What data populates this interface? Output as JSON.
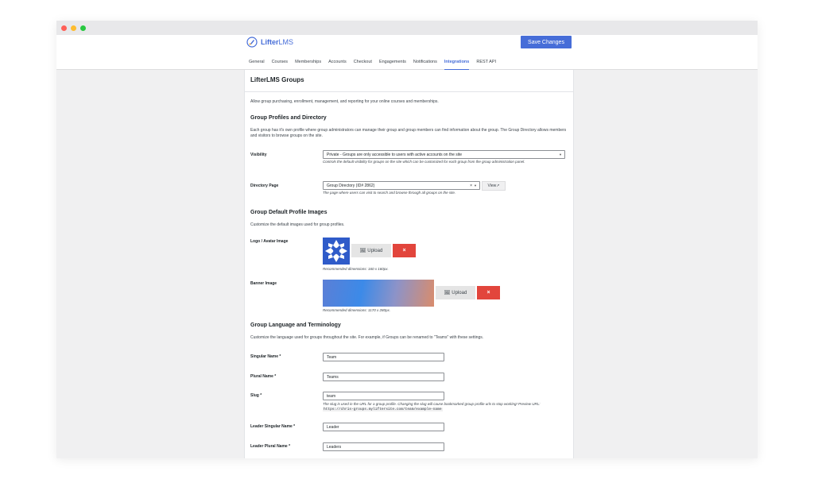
{
  "window": {
    "dots": [
      "#ff5f57",
      "#febc2e",
      "#28c840"
    ]
  },
  "header": {
    "brand_bold": "Lifter",
    "brand_light": "LMS",
    "save_label": "Save Changes",
    "accent": "#466dd8"
  },
  "tabs": [
    {
      "label": "General",
      "active": false
    },
    {
      "label": "Courses",
      "active": false
    },
    {
      "label": "Memberships",
      "active": false
    },
    {
      "label": "Accounts",
      "active": false
    },
    {
      "label": "Checkout",
      "active": false
    },
    {
      "label": "Engagements",
      "active": false
    },
    {
      "label": "Notifications",
      "active": false
    },
    {
      "label": "Integrations",
      "active": true
    },
    {
      "label": "REST API",
      "active": false
    }
  ],
  "page": {
    "title": "LifterLMS Groups",
    "intro": "Allow group purchasing, enrollment, management, and reporting for your online courses and memberships."
  },
  "profiles": {
    "heading": "Group Profiles and Directory",
    "desc": "Each group has it's own profile where group administrators can manage their group and group members can find information about the group. The Group Directory allows members and visitors to browse groups on the site.",
    "visibility_label": "Visibility",
    "visibility_value": "Private - Groups are only accessible to users with active accounts on the site",
    "visibility_hint": "Controls the default visibility for groups on the site which can be customized for each group from the group administration panel.",
    "directory_label": "Directory Page",
    "directory_value": "Group Directory (ID# 2862)",
    "directory_hint": "The page where users can visit to search and browse through all groups on the site.",
    "view_label": "View"
  },
  "images": {
    "heading": "Group Default Profile Images",
    "desc": "Customize the default images used for group profiles.",
    "logo_label": "Logo / Avatar Image",
    "logo_hint": "Recommended dimensions: 160 x 160px.",
    "banner_label": "Banner Image",
    "banner_hint": "Recommended dimensions: 1170 x 280px.",
    "upload_label": "Upload",
    "remove_label": "×"
  },
  "terminology": {
    "heading": "Group Language and Terminology",
    "desc": "Customize the language used for groups throughout the site. For example, if Groups can be renamed to \"Teams\" with these settings.",
    "singular_label": "Singular Name *",
    "singular_value": "Team",
    "plural_label": "Plural Name *",
    "plural_value": "Teams",
    "slug_label": "Slug *",
    "slug_value": "team",
    "slug_hint": "The slug is used in the URL for a group profile. Changing the slug will cause bookmarked group profile urls to stop working! Preview URL:",
    "slug_preview": "https://chris-groups.myliftersite.com/team/example-name",
    "leader_singular_label": "Leader Singular Name *",
    "leader_singular_value": "Leader",
    "leader_plural_label": "Leader Plural Name *",
    "leader_plural_value": "Leaders"
  }
}
